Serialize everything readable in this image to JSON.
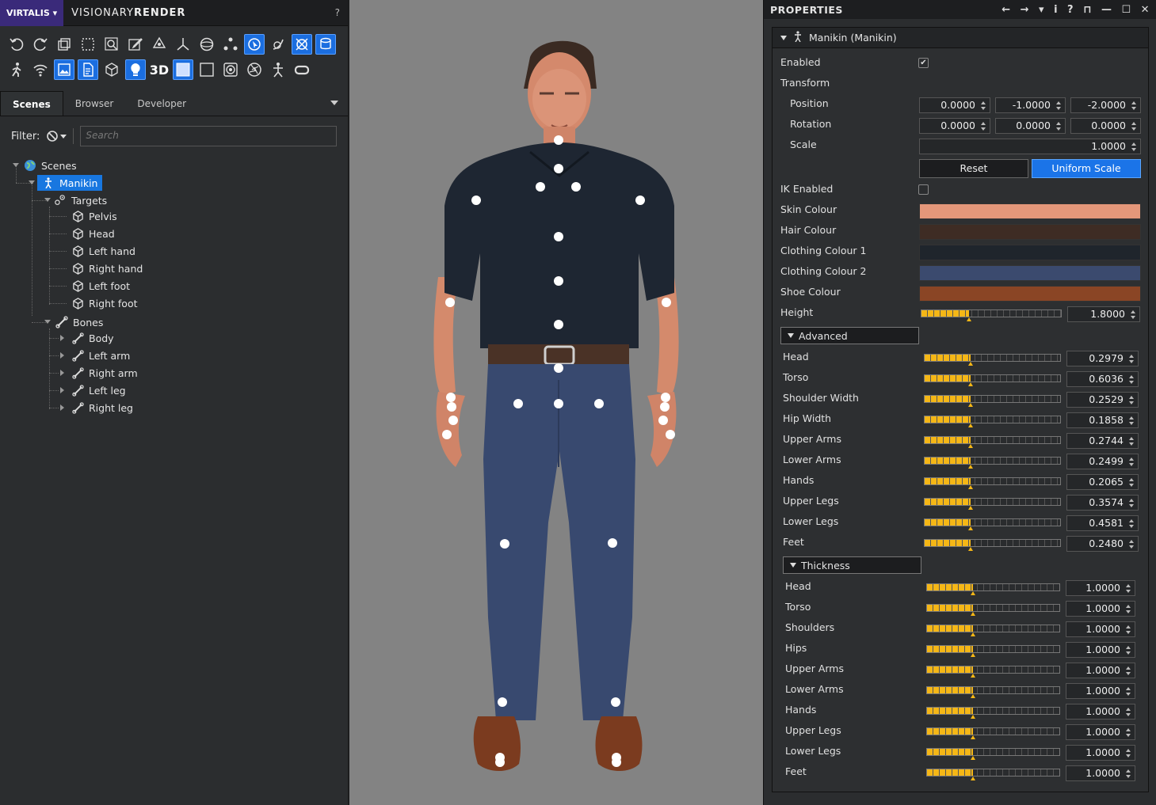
{
  "app": {
    "brand": "VIRTALIS ▾",
    "name_light": "VISIONARY",
    "name_bold": "RENDER",
    "help": "?"
  },
  "toolbar": {
    "label_3d": "3D"
  },
  "tabs": [
    "Scenes",
    "Browser",
    "Developer"
  ],
  "filter": {
    "label": "Filter:",
    "placeholder": "Search"
  },
  "tree": {
    "root": "Scenes",
    "manikin": "Manikin",
    "targets": "Targets",
    "target_items": [
      "Pelvis",
      "Head",
      "Left hand",
      "Right hand",
      "Left foot",
      "Right foot"
    ],
    "bones": "Bones",
    "bone_items": [
      "Body",
      "Left arm",
      "Right arm",
      "Left leg",
      "Right leg"
    ]
  },
  "properties": {
    "title": "PROPERTIES",
    "icons": [
      "←",
      "→",
      "▾",
      "i",
      "?",
      "⊓",
      "—",
      "☐",
      "✕"
    ],
    "object": "Manikin (Manikin)",
    "enabled_label": "Enabled",
    "transform_label": "Transform",
    "position_label": "Position",
    "position": [
      "0.0000",
      "-1.0000",
      "-2.0000"
    ],
    "rotation_label": "Rotation",
    "rotation": [
      "0.0000",
      "0.0000",
      "0.0000"
    ],
    "scale_label": "Scale",
    "scale": "1.0000",
    "reset_label": "Reset",
    "uniform_label": "Uniform Scale",
    "ik_label": "IK Enabled",
    "colours": [
      {
        "label": "Skin Colour",
        "color": "#e4977a"
      },
      {
        "label": "Hair Colour",
        "color": "#3e2c24"
      },
      {
        "label": "Clothing Colour 1",
        "color": "#1f252c"
      },
      {
        "label": "Clothing Colour 2",
        "color": "#3b4a6e"
      },
      {
        "label": "Shoe Colour",
        "color": "#8a4525"
      }
    ],
    "height_label": "Height",
    "height": "1.8000",
    "advanced_label": "Advanced",
    "advanced": [
      {
        "label": "Head",
        "value": "0.2979"
      },
      {
        "label": "Torso",
        "value": "0.6036"
      },
      {
        "label": "Shoulder Width",
        "value": "0.2529"
      },
      {
        "label": "Hip Width",
        "value": "0.1858"
      },
      {
        "label": "Upper Arms",
        "value": "0.2744"
      },
      {
        "label": "Lower Arms",
        "value": "0.2499"
      },
      {
        "label": "Hands",
        "value": "0.2065"
      },
      {
        "label": "Upper Legs",
        "value": "0.3574"
      },
      {
        "label": "Lower Legs",
        "value": "0.4581"
      },
      {
        "label": "Feet",
        "value": "0.2480"
      }
    ],
    "thickness_label": "Thickness",
    "thickness": [
      {
        "label": "Head",
        "value": "1.0000"
      },
      {
        "label": "Torso",
        "value": "1.0000"
      },
      {
        "label": "Shoulders",
        "value": "1.0000"
      },
      {
        "label": "Hips",
        "value": "1.0000"
      },
      {
        "label": "Upper Arms",
        "value": "1.0000"
      },
      {
        "label": "Lower Arms",
        "value": "1.0000"
      },
      {
        "label": "Hands",
        "value": "1.0000"
      },
      {
        "label": "Upper Legs",
        "value": "1.0000"
      },
      {
        "label": "Lower Legs",
        "value": "1.0000"
      },
      {
        "label": "Feet",
        "value": "1.0000"
      }
    ]
  }
}
